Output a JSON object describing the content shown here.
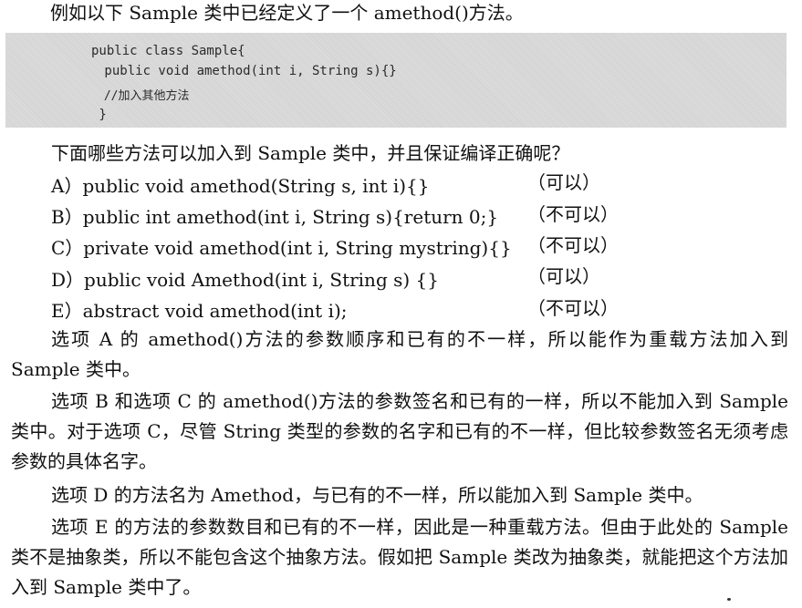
{
  "intro": "例如以下 Sample 类中已经定义了一个 amethod()方法。",
  "code": [
    "public class Sample{",
    " public void amethod(int i, String s){}",
    " //加入其他方法",
    " }"
  ],
  "question": "下面哪些方法可以加入到 Sample 类中，并且保证编译正确呢？",
  "options": [
    {
      "text": "A）public void amethod(String s, int i){}",
      "verdict": "（可以）"
    },
    {
      "text": "B）public int amethod(int i, String s){return 0;}",
      "verdict": "（不可以）"
    },
    {
      "text": "C）private void amethod(int i, String mystring){}",
      "verdict": "（不可以）"
    },
    {
      "text": "D）public void Amethod(int i, String s) {}",
      "verdict": "（可以）"
    },
    {
      "text": "E）abstract void amethod(int i);",
      "verdict": "（不可以）"
    }
  ],
  "explanations": [
    "选项 A 的 amethod()方法的参数顺序和已有的不一样，所以能作为重载方法加入到 Sample 类中。",
    "选项 B 和选项 C 的 amethod()方法的参数签名和已有的一样，所以不能加入到 Sample 类中。对于选项 C，尽管 String 类型的参数的名字和已有的不一样，但比较参数签名无须考虑参数的具体名字。",
    "选项 D 的方法名为 Amethod，与已有的不一样，所以能加入到 Sample 类中。",
    "选项 E 的方法的参数数目和已有的不一样，因此是一种重载方法。但由于此处的 Sample 类不是抽象类，所以不能包含这个抽象方法。假如把 Sample 类改为抽象类，就能把这个方法加入到 Sample 类中了。"
  ]
}
